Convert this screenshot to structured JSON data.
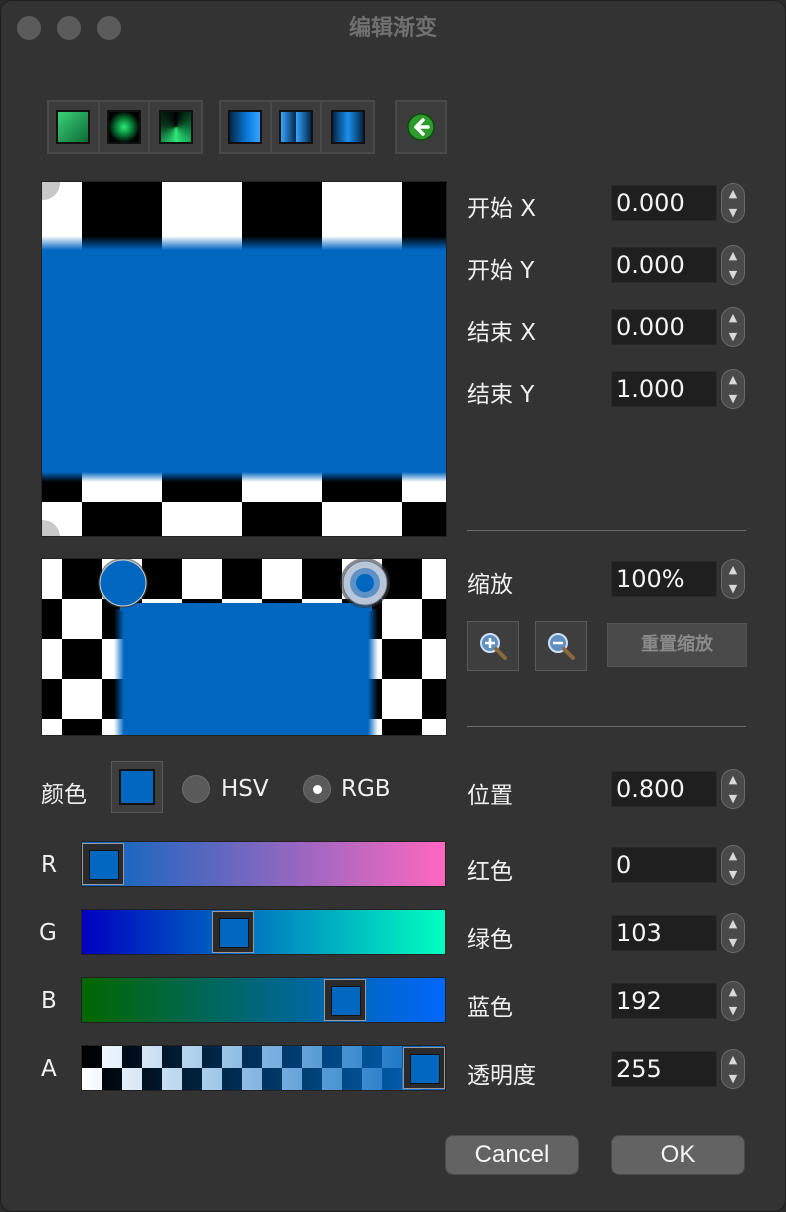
{
  "window": {
    "title": "编辑渐变"
  },
  "colors": {
    "accent": "#0067c0",
    "field_bg": "#1f1f1f",
    "panel_bg": "#333333"
  },
  "toolbar": {
    "gradient_types": [
      "linear-green-icon",
      "radial-green-icon",
      "conical-green-icon"
    ],
    "spread_modes": [
      "pad-blue-icon",
      "reflect-blue-icon",
      "repeat-blue-icon"
    ],
    "back_icon": "back-arrow-icon"
  },
  "coords": [
    {
      "label": "开始 X",
      "value": "0.000"
    },
    {
      "label": "开始 Y",
      "value": "0.000"
    },
    {
      "label": "结束 X",
      "value": "0.000"
    },
    {
      "label": "结束 Y",
      "value": "1.000"
    }
  ],
  "zoom": {
    "label": "缩放",
    "value": "100%",
    "zoom_in_icon": "zoom-in-icon",
    "zoom_out_icon": "zoom-out-icon",
    "reset_label": "重置缩放"
  },
  "color_section": {
    "label": "颜色",
    "hsv_label": "HSV",
    "rgb_label": "RGB",
    "selected_mode": "RGB"
  },
  "channels": [
    {
      "letter": "R",
      "label": "红色",
      "value": "0",
      "level": 0.0
    },
    {
      "letter": "G",
      "label": "绿色",
      "value": "103",
      "level": 0.404
    },
    {
      "letter": "B",
      "label": "蓝色",
      "value": "192",
      "level": 0.753
    },
    {
      "letter": "A",
      "label": "透明度",
      "value": "255",
      "level": 1.0
    }
  ],
  "position": {
    "label": "位置",
    "value": "0.800"
  },
  "buttons": {
    "cancel": "Cancel",
    "ok": "OK"
  }
}
